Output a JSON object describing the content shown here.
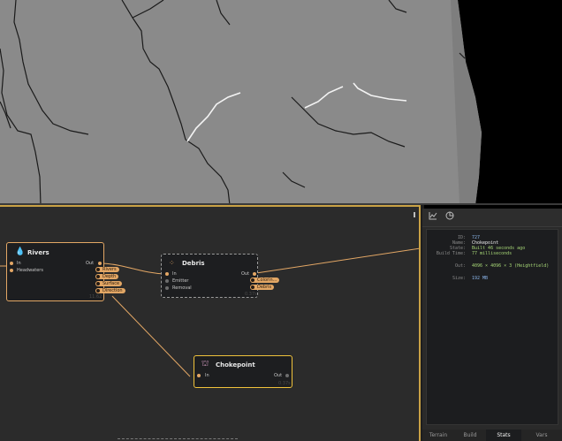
{
  "colors": {
    "accent": "#e3a765",
    "selection": "#f0c23b",
    "value_green": "#a6d676",
    "value_blue": "#8ab4e8"
  },
  "nodes": {
    "rivers": {
      "title": "Rivers",
      "icon": "droplet-icon",
      "inputs": [
        "In",
        "Headwaters"
      ],
      "out_label": "Out",
      "outputs": [
        "Rivers",
        "Depth",
        "Surface",
        "Direction"
      ],
      "time": "11.62"
    },
    "debris": {
      "title": "Debris",
      "icon": "scatter-icon",
      "inputs": [
        "In",
        "Emitter",
        "Removal"
      ],
      "out_label": "Out",
      "outputs": [
        "Colorin...",
        "Debris"
      ],
      "time": "0.37s"
    },
    "chokepoint": {
      "title": "Chokepoint",
      "icon": "chokepoint-icon",
      "inputs": [
        "In"
      ],
      "out_label": "Out",
      "time": "0.37s"
    }
  },
  "stats": {
    "id": {
      "label": "ID:",
      "value": "727"
    },
    "name": {
      "label": "Name:",
      "value": "Chokepoint"
    },
    "state": {
      "label": "State:",
      "value": "Built 46 seconds ago"
    },
    "build_time": {
      "label": "Build Time:",
      "value": "77 milliseconds"
    },
    "out": {
      "label": "Out:",
      "value": "4096 × 4096 × 3 (Heightfield)"
    },
    "size": {
      "label": "Size:",
      "value": "192 MB"
    }
  },
  "tabs": [
    "Terrain",
    "Build",
    "Stats",
    "Vars"
  ],
  "active_tab": "Stats",
  "toolbar": [
    "chart-icon",
    "pie-icon"
  ]
}
